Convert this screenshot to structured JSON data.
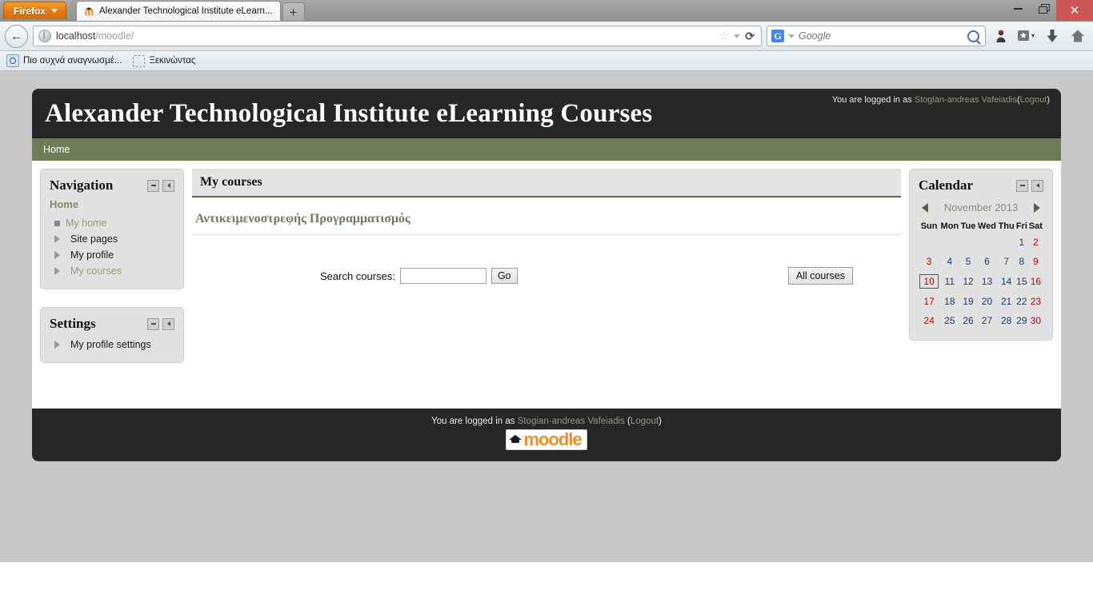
{
  "browser": {
    "firefox_button": "Firefox",
    "tab_title": "Alexander Technological Institute eLearn...",
    "new_tab_label": "+",
    "window_minimize": "minimize-icon",
    "window_restore": "restore-icon",
    "window_close": "✕",
    "back_arrow": "←",
    "url_host": "localhost",
    "url_path": "/moodle/",
    "star_icon": "☆",
    "reload_icon": "⟳",
    "search_engine": "G",
    "search_placeholder": "Google",
    "bookmarks": [
      {
        "label": "Πιο συχνά αναγνωσμέ...",
        "icon": "most-visited-icon"
      },
      {
        "label": "Ξεκινώντας",
        "icon": "getting-started-icon"
      }
    ]
  },
  "site": {
    "title": "Alexander Technological Institute eLearning Courses",
    "login_prefix": "You are logged in as",
    "login_user": "Stogian-andreas Vafeiadis",
    "logout_open": "(",
    "logout_label": "Logout",
    "logout_close": ")",
    "breadcrumb": "Home"
  },
  "navigation_block": {
    "title": "Navigation",
    "collapse_icon": "collapse-icon",
    "dock_icon": "dock-icon",
    "root": "Home",
    "items": [
      {
        "label": "My home",
        "marker": "square",
        "dim": true
      },
      {
        "label": "Site pages",
        "marker": "triangle",
        "dim": false
      },
      {
        "label": "My profile",
        "marker": "triangle",
        "dim": false
      },
      {
        "label": "My courses",
        "marker": "triangle",
        "dim": true
      }
    ]
  },
  "settings_block": {
    "title": "Settings",
    "collapse_icon": "collapse-icon",
    "dock_icon": "dock-icon",
    "items": [
      {
        "label": "My profile settings",
        "marker": "triangle"
      }
    ]
  },
  "main": {
    "region_title": "My courses",
    "courses": [
      {
        "name": "Αντικειμενοστρεφής Προγραμματισμός"
      }
    ],
    "search_label": "Search courses:",
    "search_value": "",
    "search_placeholder": "",
    "go_button": "Go",
    "all_courses_button": "All courses"
  },
  "calendar_block": {
    "title": "Calendar",
    "collapse_icon": "collapse-icon",
    "dock_icon": "dock-icon",
    "prev_label": "◀",
    "next_label": "▶",
    "month": "November 2013",
    "weekday_headers": [
      "Sun",
      "Mon",
      "Tue",
      "Wed",
      "Thu",
      "Fri",
      "Sat"
    ],
    "today": 10,
    "weeks": [
      [
        null,
        null,
        null,
        null,
        null,
        1,
        2
      ],
      [
        3,
        4,
        5,
        6,
        7,
        8,
        9
      ],
      [
        10,
        11,
        12,
        13,
        14,
        15,
        16
      ],
      [
        17,
        18,
        19,
        20,
        21,
        22,
        23
      ],
      [
        24,
        25,
        26,
        27,
        28,
        29,
        30
      ]
    ]
  },
  "footer": {
    "login_prefix": "You are logged in as",
    "login_user": "Stogian-andreas Vafeiadis",
    "logout_open": "(",
    "logout_label": "Logout",
    "logout_close": ")",
    "logo_text": "moodle"
  },
  "colors": {
    "header_dark": "#262626",
    "breadcrumb_green": "#6b7d56",
    "link_green": "#8c9e75",
    "course_green": "#6d7d5a",
    "weekend_red": "#cc0000",
    "weekday_blue": "#1a3a6b",
    "page_background": "#c8c8c8"
  }
}
